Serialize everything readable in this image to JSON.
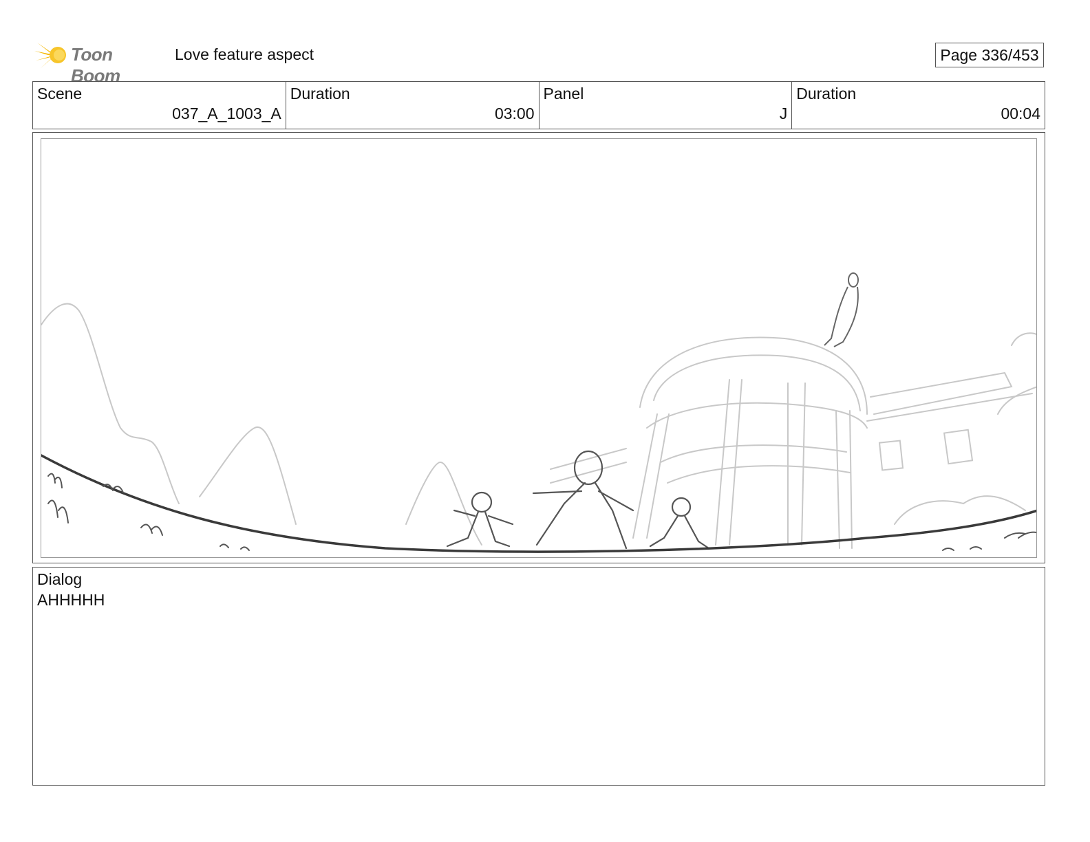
{
  "header": {
    "logo_text": "Toon Boom",
    "project_title": "Love feature aspect",
    "page_label": "Page 336/453"
  },
  "info": {
    "scene_label": "Scene",
    "scene_value": "037_A_1003_A",
    "scene_duration_label": "Duration",
    "scene_duration_value": "03:00",
    "panel_label": "Panel",
    "panel_value": "J",
    "panel_duration_label": "Duration",
    "panel_duration_value": "00:04"
  },
  "dialog": {
    "label": "Dialog",
    "text": "AHHHHH"
  },
  "colors": {
    "logo_yellow": "#f5b800",
    "sketch_light": "#c8c8c8",
    "sketch_dark": "#3a3a3a"
  }
}
